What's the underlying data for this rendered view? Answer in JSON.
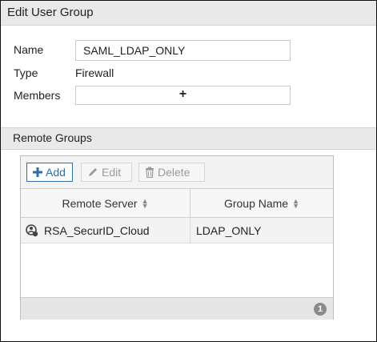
{
  "dialog": {
    "title": "Edit User Group"
  },
  "form": {
    "name_label": "Name",
    "name_value": "SAML_LDAP_ONLY",
    "type_label": "Type",
    "type_value": "Firewall",
    "members_label": "Members",
    "members_add_symbol": "+"
  },
  "remote_groups": {
    "section_title": "Remote Groups",
    "toolbar": {
      "add_label": "Add",
      "edit_label": "Edit",
      "delete_label": "Delete"
    },
    "columns": [
      "Remote Server",
      "Group Name"
    ],
    "rows": [
      {
        "remote_server": "RSA_SecurID_Cloud",
        "group_name": "LDAP_ONLY"
      }
    ],
    "count": "1"
  },
  "colors": {
    "accent": "#2f6ea6",
    "disabled": "#9a9a9a",
    "header_bg": "#e9e9e9"
  },
  "icons": {
    "add": "plus-icon",
    "edit": "pencil-icon",
    "delete": "trash-icon",
    "server": "remote-server-icon",
    "sort": "sort-icon"
  }
}
